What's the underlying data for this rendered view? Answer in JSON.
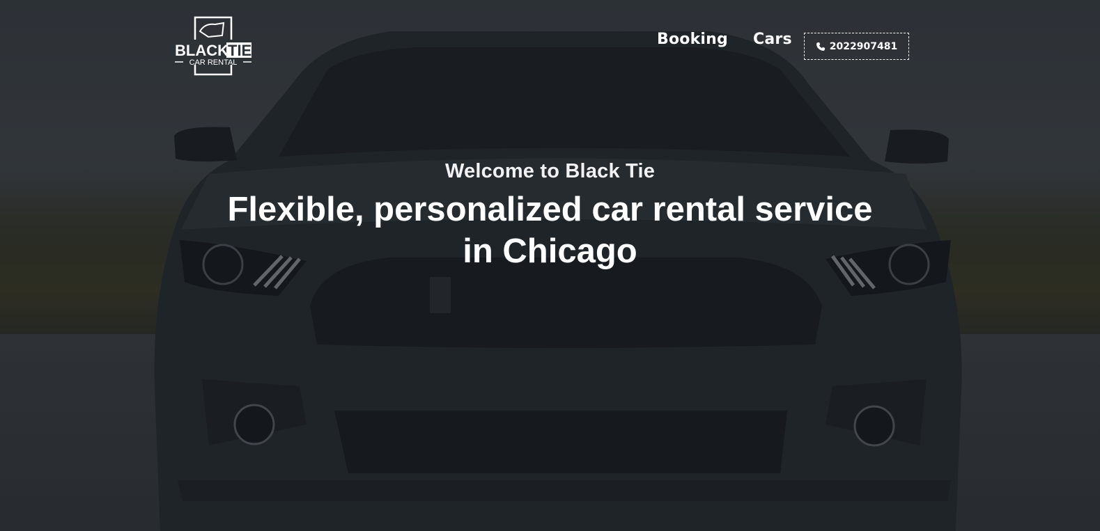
{
  "brand": {
    "logo_text_main": "BLACK",
    "logo_text_highlight": "TIE",
    "logo_text_sub": "CAR RENTAL"
  },
  "nav": {
    "items": [
      {
        "label": "Booking"
      },
      {
        "label": "Cars"
      }
    ],
    "phone": {
      "icon": "phone-icon",
      "number": "2022907481"
    }
  },
  "hero": {
    "eyebrow": "Welcome to Black Tie",
    "headline": "Flexible, personalized car rental service in Chicago"
  },
  "colors": {
    "text": "#ffffff",
    "overlay": "#14181c"
  }
}
